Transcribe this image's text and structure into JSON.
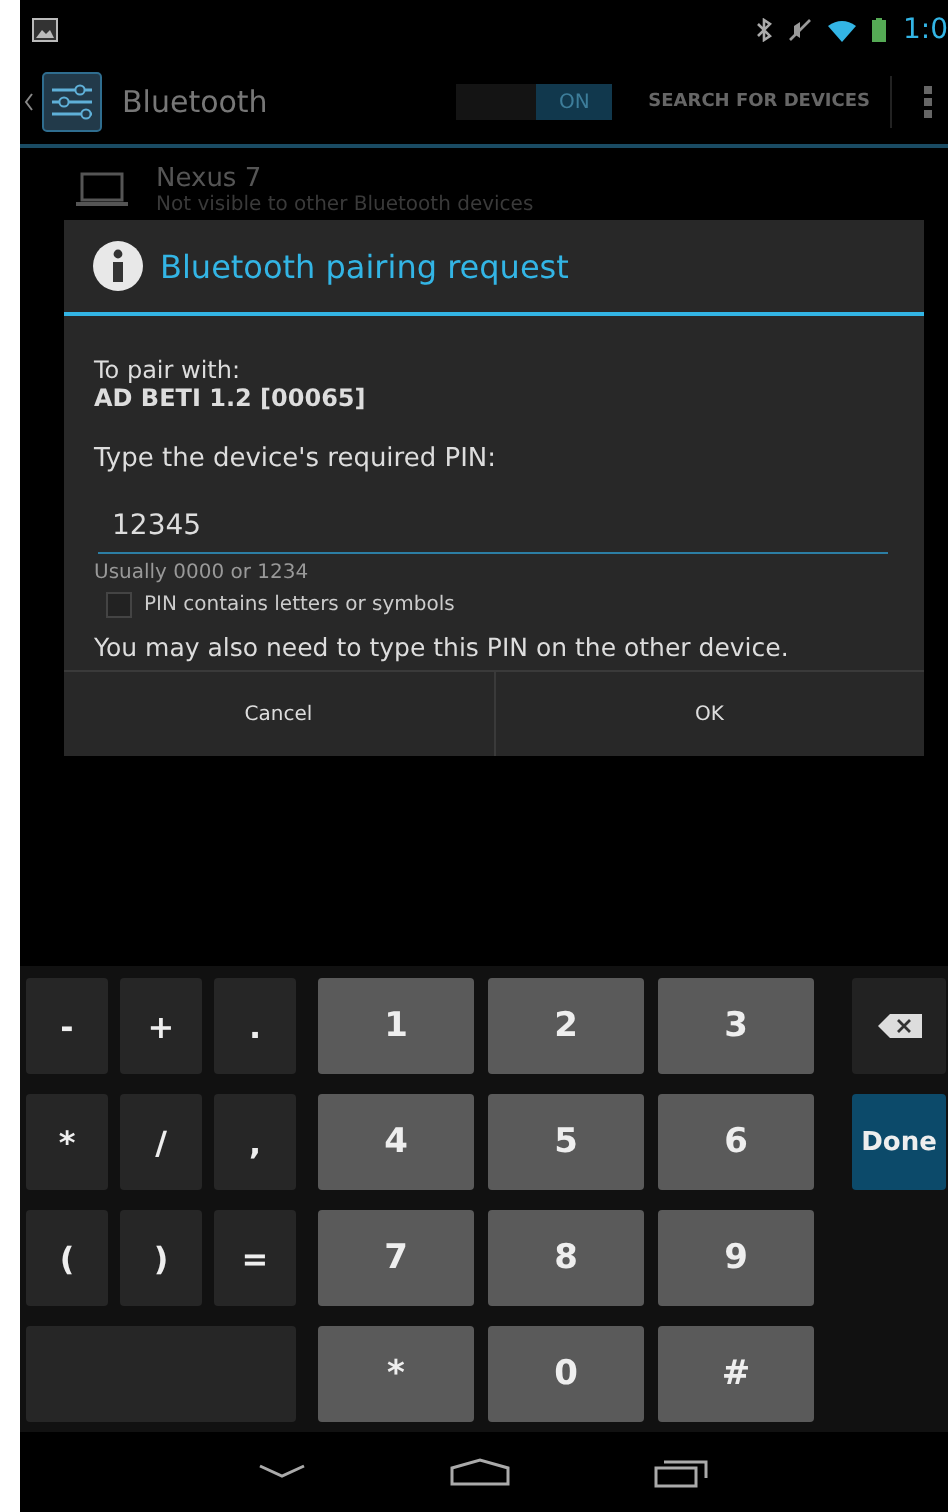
{
  "status_bar": {
    "time": "1:0"
  },
  "action_bar": {
    "title": "Bluetooth",
    "toggle": {
      "label": "ON",
      "on": true
    },
    "action": "SEARCH FOR DEVICES"
  },
  "devices": [
    {
      "name": "Nexus 7",
      "subtitle": "Not visible to other Bluetooth devices"
    }
  ],
  "dialog": {
    "title": "Bluetooth pairing request",
    "intro": "To pair with:",
    "device": "AD BETI 1.2 [00065]",
    "prompt": "Type the device's required PIN:",
    "pin": {
      "value": "12345"
    },
    "hint": "Usually 0000 or 1234",
    "checkbox": {
      "label": "PIN contains letters or symbols",
      "checked": false
    },
    "note": "You may also need to type this PIN on the other device.",
    "buttons": [
      "Cancel",
      "OK"
    ]
  },
  "keyboard": {
    "symbols": [
      "-",
      "+",
      ".",
      "*",
      "/",
      ",",
      "(",
      ")",
      "="
    ],
    "digits": [
      "1",
      "2",
      "3",
      "4",
      "5",
      "6",
      "7",
      "8",
      "9",
      "*",
      "0",
      "#"
    ],
    "actions": [
      {
        "kind": "backspace"
      },
      {
        "kind": "done",
        "label": "Done"
      }
    ]
  }
}
